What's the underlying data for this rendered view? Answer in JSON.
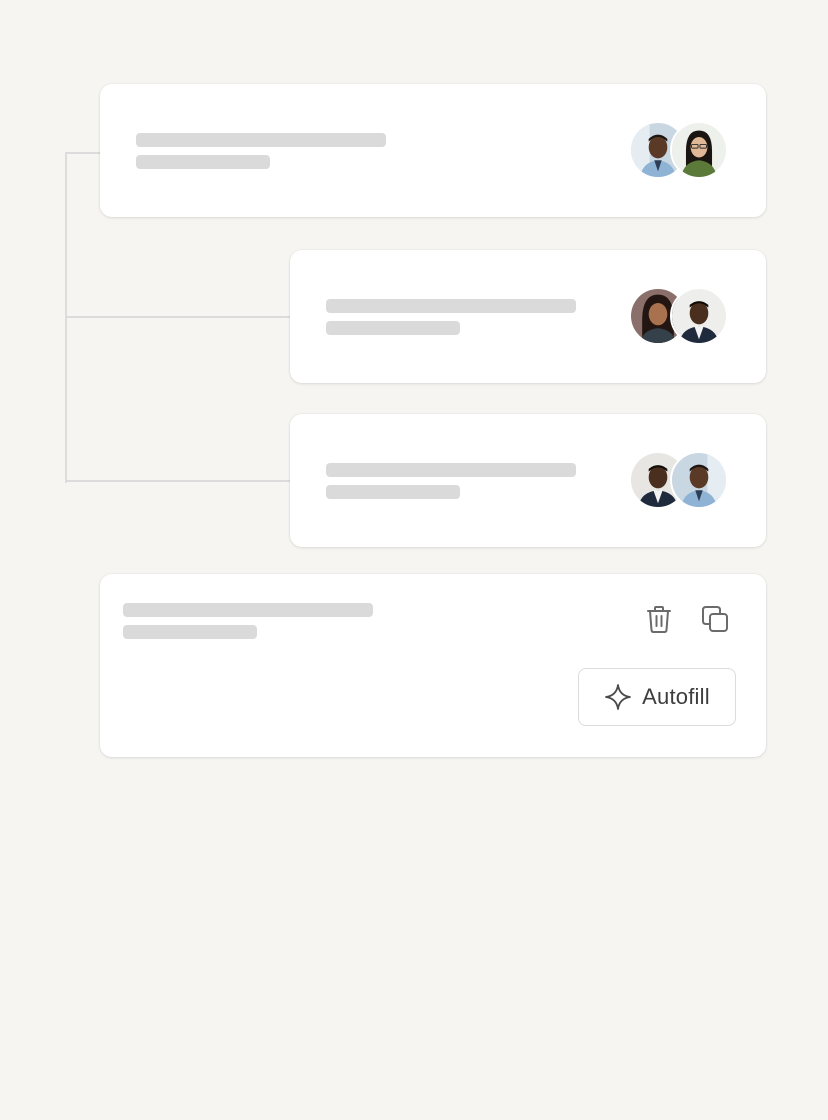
{
  "colors": {
    "background": "#f6f5f2",
    "card": "#ffffff",
    "skeleton": "#dadada",
    "connector": "#dcdcdc",
    "icon": "#6b6b6b",
    "text": "#3d3d3d"
  },
  "cards": [
    {
      "avatars": [
        "person-avatar",
        "person-avatar"
      ]
    },
    {
      "avatars": [
        "person-avatar",
        "person-avatar"
      ]
    },
    {
      "avatars": [
        "person-avatar",
        "person-avatar"
      ]
    }
  ],
  "footer_card": {
    "icons": [
      "trash-icon",
      "copy-icon"
    ],
    "autofill_label": "Autofill",
    "autofill_icon": "sparkle-icon"
  }
}
